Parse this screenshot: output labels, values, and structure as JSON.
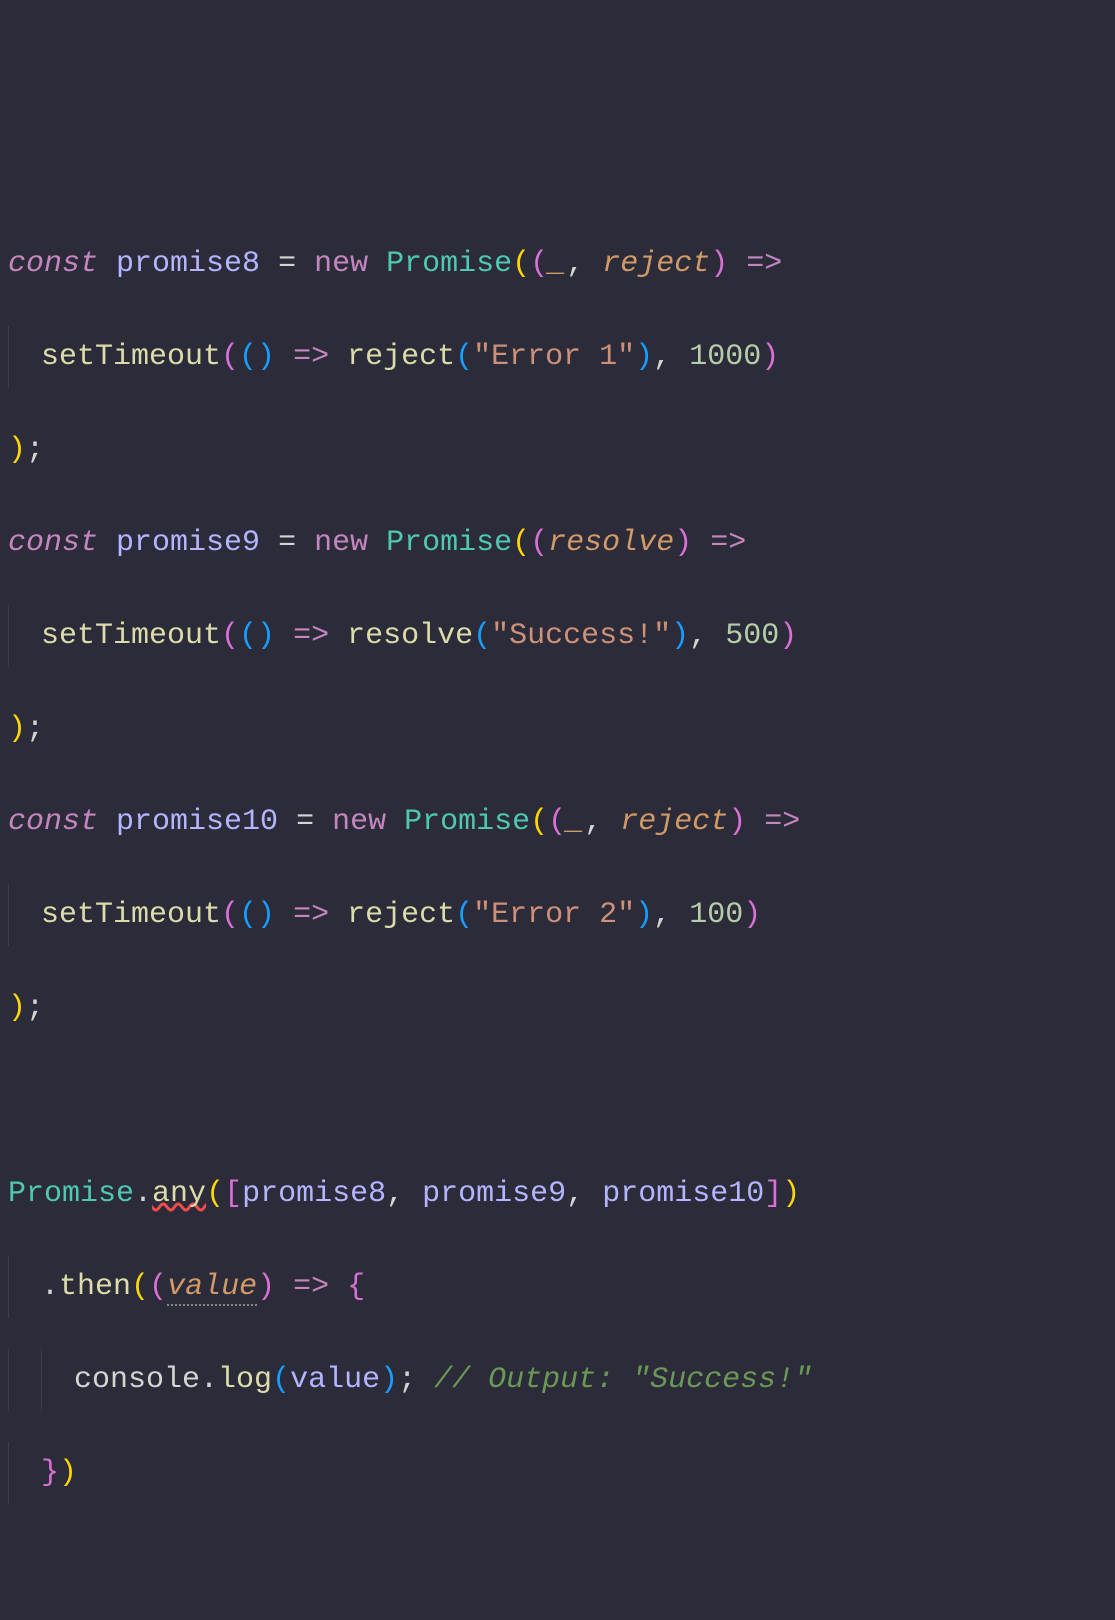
{
  "line1": {
    "const": "const",
    "var": "promise8",
    "eq": " = ",
    "new": "new",
    "cls": "Promise",
    "p1": "((",
    "param1": "_",
    "comma": ", ",
    "param2": "reject",
    "p2": ")",
    "arrow": " =>"
  },
  "line2": {
    "fn": "setTimeout",
    "p1": "(()",
    "arrow": " => ",
    "fn2": "reject",
    "p2": "(",
    "str": "\"Error 1\"",
    "p3": ")",
    "comma": ", ",
    "num": "1000",
    "p4": ")"
  },
  "line3": {
    "close": ");"
  },
  "line4": {
    "const": "const",
    "var": "promise9",
    "eq": " = ",
    "new": "new",
    "cls": "Promise",
    "p1": "((",
    "param1": "resolve",
    "p2": ")",
    "arrow": " =>"
  },
  "line5": {
    "fn": "setTimeout",
    "p1": "(()",
    "arrow": " => ",
    "fn2": "resolve",
    "p2": "(",
    "str": "\"Success!\"",
    "p3": ")",
    "comma": ", ",
    "num": "500",
    "p4": ")"
  },
  "line6": {
    "close": ");"
  },
  "line7": {
    "const": "const",
    "var": "promise10",
    "eq": " = ",
    "new": "new",
    "cls": "Promise",
    "p1": "((",
    "param1": "_",
    "comma": ", ",
    "param2": "reject",
    "p2": ")",
    "arrow": " =>"
  },
  "line8": {
    "fn": "setTimeout",
    "p1": "(()",
    "arrow": " => ",
    "fn2": "reject",
    "p2": "(",
    "str": "\"Error 2\"",
    "p3": ")",
    "comma": ", ",
    "num": "100",
    "p4": ")"
  },
  "line9": {
    "close": ");"
  },
  "line11": {
    "cls": "Promise",
    "dot": ".",
    "method": "any",
    "p1": "([",
    "v1": "promise8",
    "c1": ", ",
    "v2": "promise9",
    "c2": ", ",
    "v3": "promise10",
    "p2": "])"
  },
  "line12": {
    "dot": ".",
    "method": "then",
    "p1": "((",
    "param": "value",
    "p2": ")",
    "arrow": " => ",
    "brace": "{"
  },
  "line13": {
    "obj": "console",
    "dot": ".",
    "method": "log",
    "p1": "(",
    "var": "value",
    "p2": ");",
    "comment": " // Output: \"Success!\""
  },
  "line14": {
    "close": "})"
  }
}
